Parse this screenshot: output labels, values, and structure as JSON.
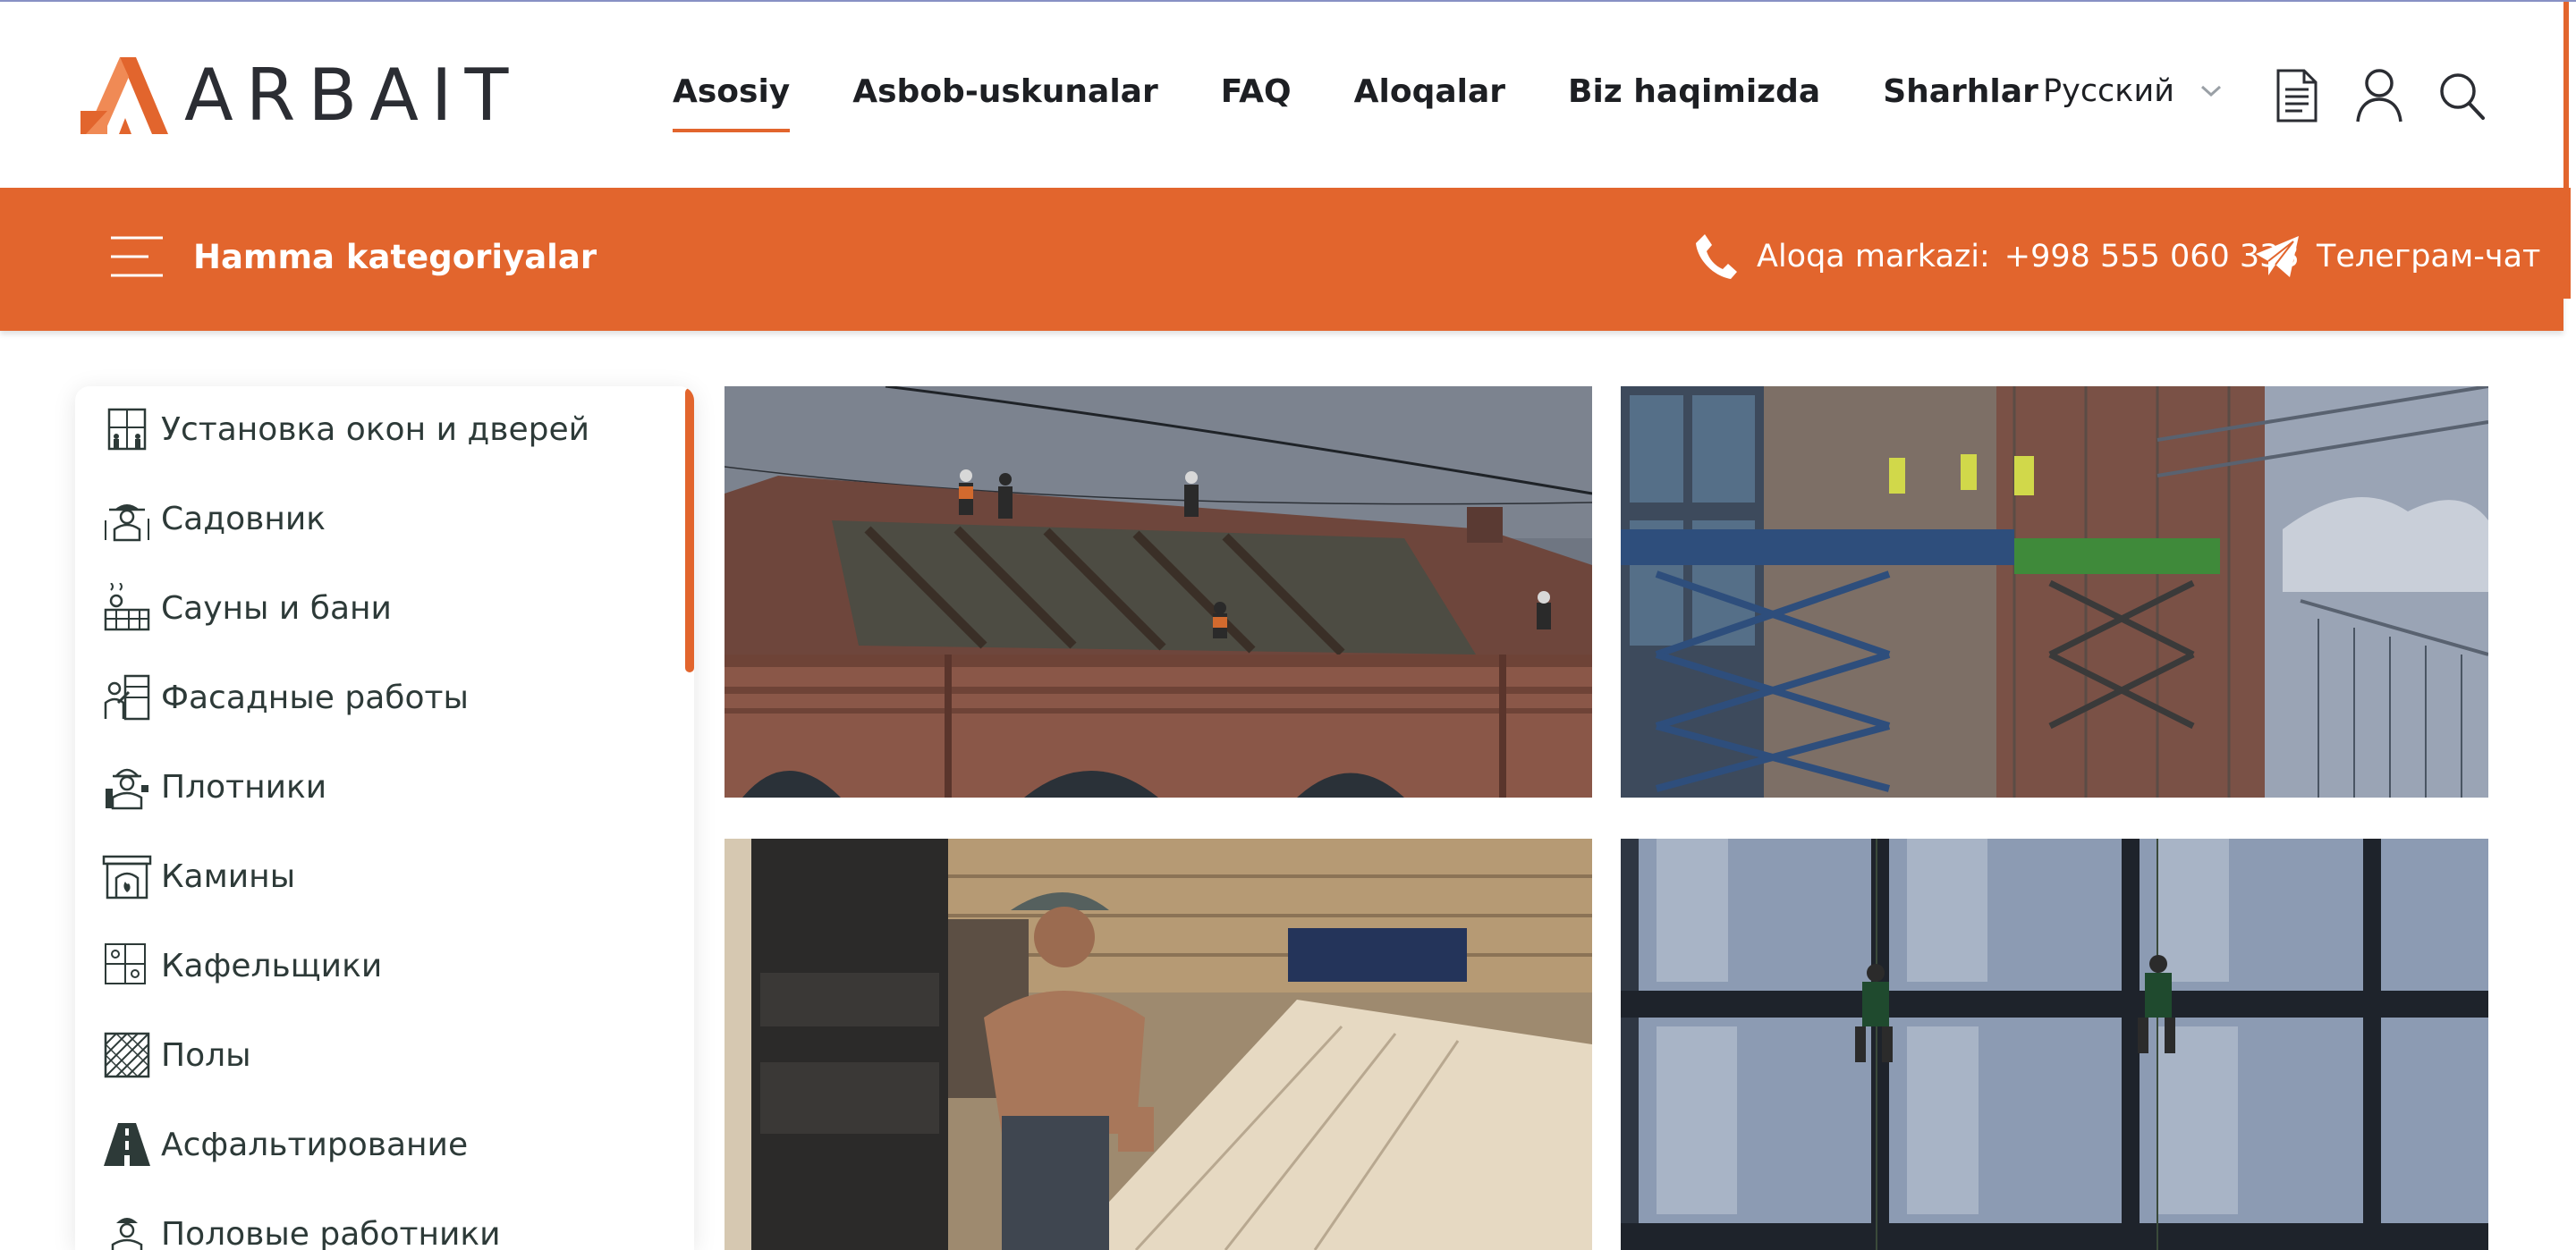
{
  "brand": {
    "name": "ARBAIT",
    "accent": "#e2652d"
  },
  "nav": [
    {
      "label": "Asosiy",
      "active": true
    },
    {
      "label": "Asbob-uskunalar",
      "active": false
    },
    {
      "label": "FAQ",
      "active": false
    },
    {
      "label": "Aloqalar",
      "active": false
    },
    {
      "label": "Biz haqimizda",
      "active": false
    },
    {
      "label": "Sharhlar",
      "active": false
    }
  ],
  "header": {
    "language": "Русский",
    "icons": [
      "document-icon",
      "user-icon",
      "search-icon"
    ]
  },
  "bar": {
    "categories_label": "Hamma kategoriyalar",
    "contact_label": "Aloqa markazi:",
    "contact_phone": "+998 555 060 333",
    "telegram_label": "Телеграм-чат"
  },
  "sidebar": {
    "items": [
      {
        "label": "Установка окон и дверей",
        "icon": "window-door-icon"
      },
      {
        "label": "Садовник",
        "icon": "gardener-icon"
      },
      {
        "label": "Сауны и бани",
        "icon": "sauna-icon"
      },
      {
        "label": "Фасадные работы",
        "icon": "facade-icon"
      },
      {
        "label": "Плотники",
        "icon": "carpenter-icon"
      },
      {
        "label": "Камины",
        "icon": "fireplace-icon"
      },
      {
        "label": "Кафельщики",
        "icon": "tiles-icon"
      },
      {
        "label": "Полы",
        "icon": "floor-icon"
      },
      {
        "label": "Асфальтирование",
        "icon": "road-icon"
      },
      {
        "label": "Половые работники",
        "icon": "worker-icon"
      }
    ]
  },
  "tiles": [
    {
      "subject": "roof-workers-photo"
    },
    {
      "subject": "scissor-lift-facade-photo"
    },
    {
      "subject": "log-cabin-carpenter-photo"
    },
    {
      "subject": "window-climbers-photo"
    }
  ]
}
